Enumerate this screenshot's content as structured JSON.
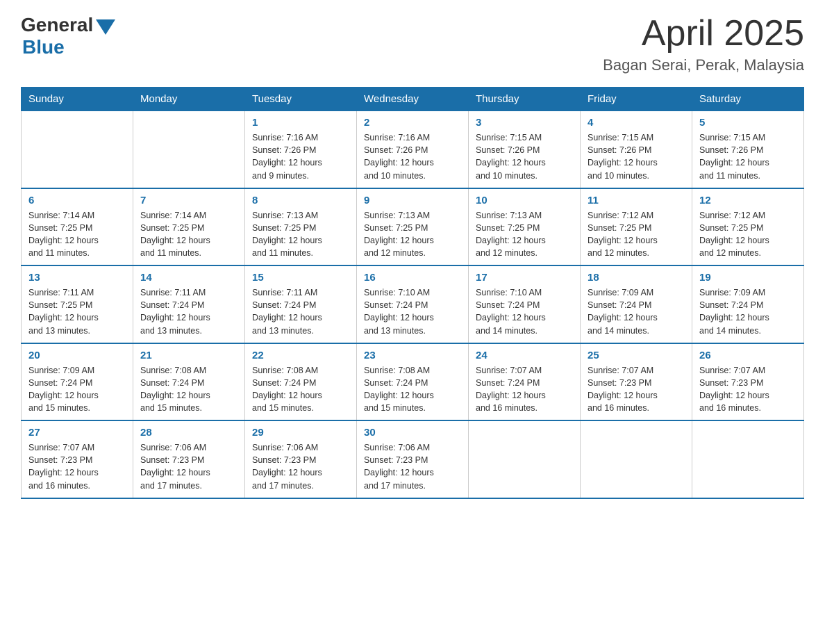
{
  "header": {
    "logo_general": "General",
    "logo_blue": "Blue",
    "month_title": "April 2025",
    "location": "Bagan Serai, Perak, Malaysia"
  },
  "weekdays": [
    "Sunday",
    "Monday",
    "Tuesday",
    "Wednesday",
    "Thursday",
    "Friday",
    "Saturday"
  ],
  "weeks": [
    [
      {
        "day": "",
        "info": ""
      },
      {
        "day": "",
        "info": ""
      },
      {
        "day": "1",
        "info": "Sunrise: 7:16 AM\nSunset: 7:26 PM\nDaylight: 12 hours\nand 9 minutes."
      },
      {
        "day": "2",
        "info": "Sunrise: 7:16 AM\nSunset: 7:26 PM\nDaylight: 12 hours\nand 10 minutes."
      },
      {
        "day": "3",
        "info": "Sunrise: 7:15 AM\nSunset: 7:26 PM\nDaylight: 12 hours\nand 10 minutes."
      },
      {
        "day": "4",
        "info": "Sunrise: 7:15 AM\nSunset: 7:26 PM\nDaylight: 12 hours\nand 10 minutes."
      },
      {
        "day": "5",
        "info": "Sunrise: 7:15 AM\nSunset: 7:26 PM\nDaylight: 12 hours\nand 11 minutes."
      }
    ],
    [
      {
        "day": "6",
        "info": "Sunrise: 7:14 AM\nSunset: 7:25 PM\nDaylight: 12 hours\nand 11 minutes."
      },
      {
        "day": "7",
        "info": "Sunrise: 7:14 AM\nSunset: 7:25 PM\nDaylight: 12 hours\nand 11 minutes."
      },
      {
        "day": "8",
        "info": "Sunrise: 7:13 AM\nSunset: 7:25 PM\nDaylight: 12 hours\nand 11 minutes."
      },
      {
        "day": "9",
        "info": "Sunrise: 7:13 AM\nSunset: 7:25 PM\nDaylight: 12 hours\nand 12 minutes."
      },
      {
        "day": "10",
        "info": "Sunrise: 7:13 AM\nSunset: 7:25 PM\nDaylight: 12 hours\nand 12 minutes."
      },
      {
        "day": "11",
        "info": "Sunrise: 7:12 AM\nSunset: 7:25 PM\nDaylight: 12 hours\nand 12 minutes."
      },
      {
        "day": "12",
        "info": "Sunrise: 7:12 AM\nSunset: 7:25 PM\nDaylight: 12 hours\nand 12 minutes."
      }
    ],
    [
      {
        "day": "13",
        "info": "Sunrise: 7:11 AM\nSunset: 7:25 PM\nDaylight: 12 hours\nand 13 minutes."
      },
      {
        "day": "14",
        "info": "Sunrise: 7:11 AM\nSunset: 7:24 PM\nDaylight: 12 hours\nand 13 minutes."
      },
      {
        "day": "15",
        "info": "Sunrise: 7:11 AM\nSunset: 7:24 PM\nDaylight: 12 hours\nand 13 minutes."
      },
      {
        "day": "16",
        "info": "Sunrise: 7:10 AM\nSunset: 7:24 PM\nDaylight: 12 hours\nand 13 minutes."
      },
      {
        "day": "17",
        "info": "Sunrise: 7:10 AM\nSunset: 7:24 PM\nDaylight: 12 hours\nand 14 minutes."
      },
      {
        "day": "18",
        "info": "Sunrise: 7:09 AM\nSunset: 7:24 PM\nDaylight: 12 hours\nand 14 minutes."
      },
      {
        "day": "19",
        "info": "Sunrise: 7:09 AM\nSunset: 7:24 PM\nDaylight: 12 hours\nand 14 minutes."
      }
    ],
    [
      {
        "day": "20",
        "info": "Sunrise: 7:09 AM\nSunset: 7:24 PM\nDaylight: 12 hours\nand 15 minutes."
      },
      {
        "day": "21",
        "info": "Sunrise: 7:08 AM\nSunset: 7:24 PM\nDaylight: 12 hours\nand 15 minutes."
      },
      {
        "day": "22",
        "info": "Sunrise: 7:08 AM\nSunset: 7:24 PM\nDaylight: 12 hours\nand 15 minutes."
      },
      {
        "day": "23",
        "info": "Sunrise: 7:08 AM\nSunset: 7:24 PM\nDaylight: 12 hours\nand 15 minutes."
      },
      {
        "day": "24",
        "info": "Sunrise: 7:07 AM\nSunset: 7:24 PM\nDaylight: 12 hours\nand 16 minutes."
      },
      {
        "day": "25",
        "info": "Sunrise: 7:07 AM\nSunset: 7:23 PM\nDaylight: 12 hours\nand 16 minutes."
      },
      {
        "day": "26",
        "info": "Sunrise: 7:07 AM\nSunset: 7:23 PM\nDaylight: 12 hours\nand 16 minutes."
      }
    ],
    [
      {
        "day": "27",
        "info": "Sunrise: 7:07 AM\nSunset: 7:23 PM\nDaylight: 12 hours\nand 16 minutes."
      },
      {
        "day": "28",
        "info": "Sunrise: 7:06 AM\nSunset: 7:23 PM\nDaylight: 12 hours\nand 17 minutes."
      },
      {
        "day": "29",
        "info": "Sunrise: 7:06 AM\nSunset: 7:23 PM\nDaylight: 12 hours\nand 17 minutes."
      },
      {
        "day": "30",
        "info": "Sunrise: 7:06 AM\nSunset: 7:23 PM\nDaylight: 12 hours\nand 17 minutes."
      },
      {
        "day": "",
        "info": ""
      },
      {
        "day": "",
        "info": ""
      },
      {
        "day": "",
        "info": ""
      }
    ]
  ]
}
